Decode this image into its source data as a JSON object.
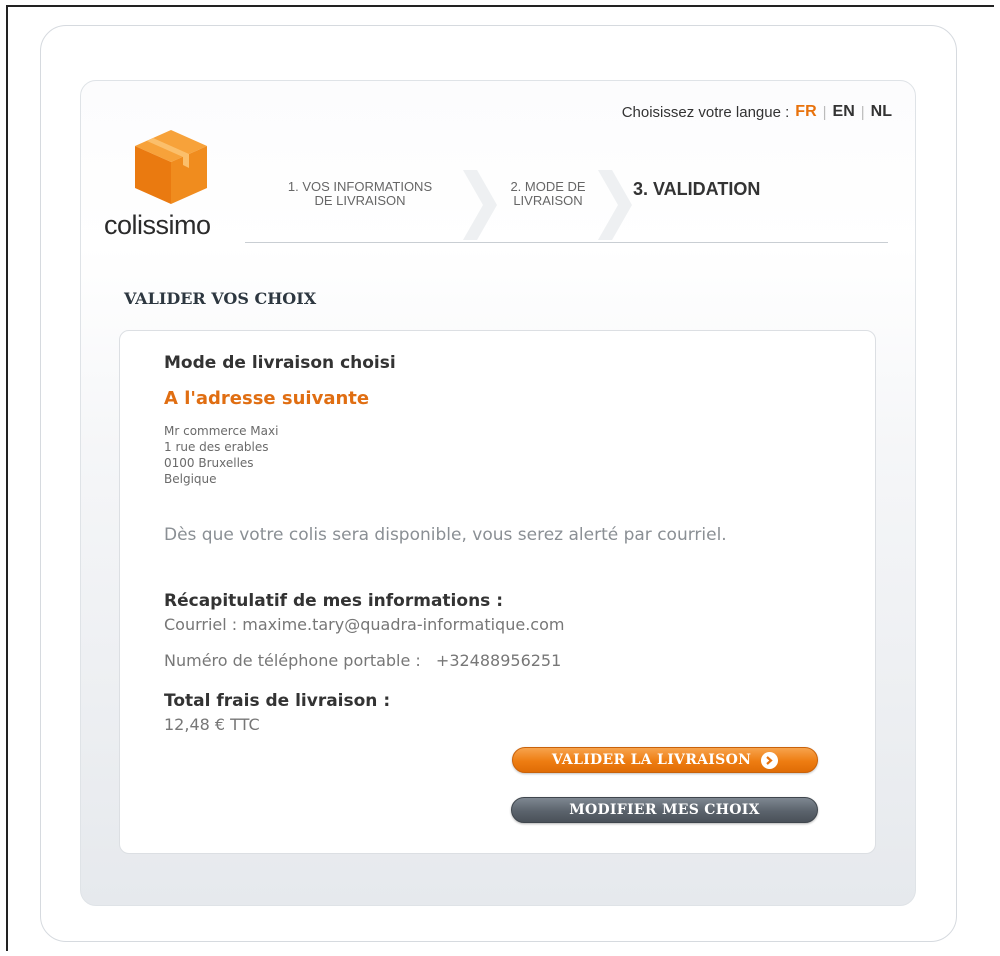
{
  "header": {
    "language_label": "Choisissez votre langue :",
    "languages": [
      {
        "code": "FR",
        "active": true
      },
      {
        "code": "EN",
        "active": false
      },
      {
        "code": "NL",
        "active": false
      }
    ],
    "logo_text": "colissimo",
    "logo_icon": "box-icon"
  },
  "steps": [
    {
      "line1": "1. VOS INFORMATIONS",
      "line2": "DE LIVRAISON"
    },
    {
      "line1": "2. MODE DE",
      "line2": "LIVRAISON"
    },
    {
      "line1": "3. VALIDATION",
      "line2": ""
    }
  ],
  "section": {
    "title": "VALIDER VOS CHOIX"
  },
  "card": {
    "mode_heading": "Mode de livraison choisi",
    "mode_value": "A l'adresse suivante",
    "address": [
      "Mr  commerce Maxi",
      "1 rue des erables",
      "0100 Bruxelles",
      "Belgique"
    ],
    "notice": "Dès que votre colis sera disponible, vous serez alerté par courriel.",
    "recap_heading": "Récapitulatif de mes informations :",
    "email_line": "Courriel : maxime.tary@quadra-informatique.com",
    "phone_label": "Numéro de téléphone portable :",
    "phone_value": "+32488956251",
    "total_heading": "Total frais de livraison :",
    "total_value": "12,48 € TTC"
  },
  "buttons": {
    "validate": "VALIDER LA LIVRAISON",
    "modify": "MODIFIER MES CHOIX"
  },
  "colors": {
    "accent": "#e8720c",
    "text": "#333333",
    "button_dark": "#555d66"
  }
}
